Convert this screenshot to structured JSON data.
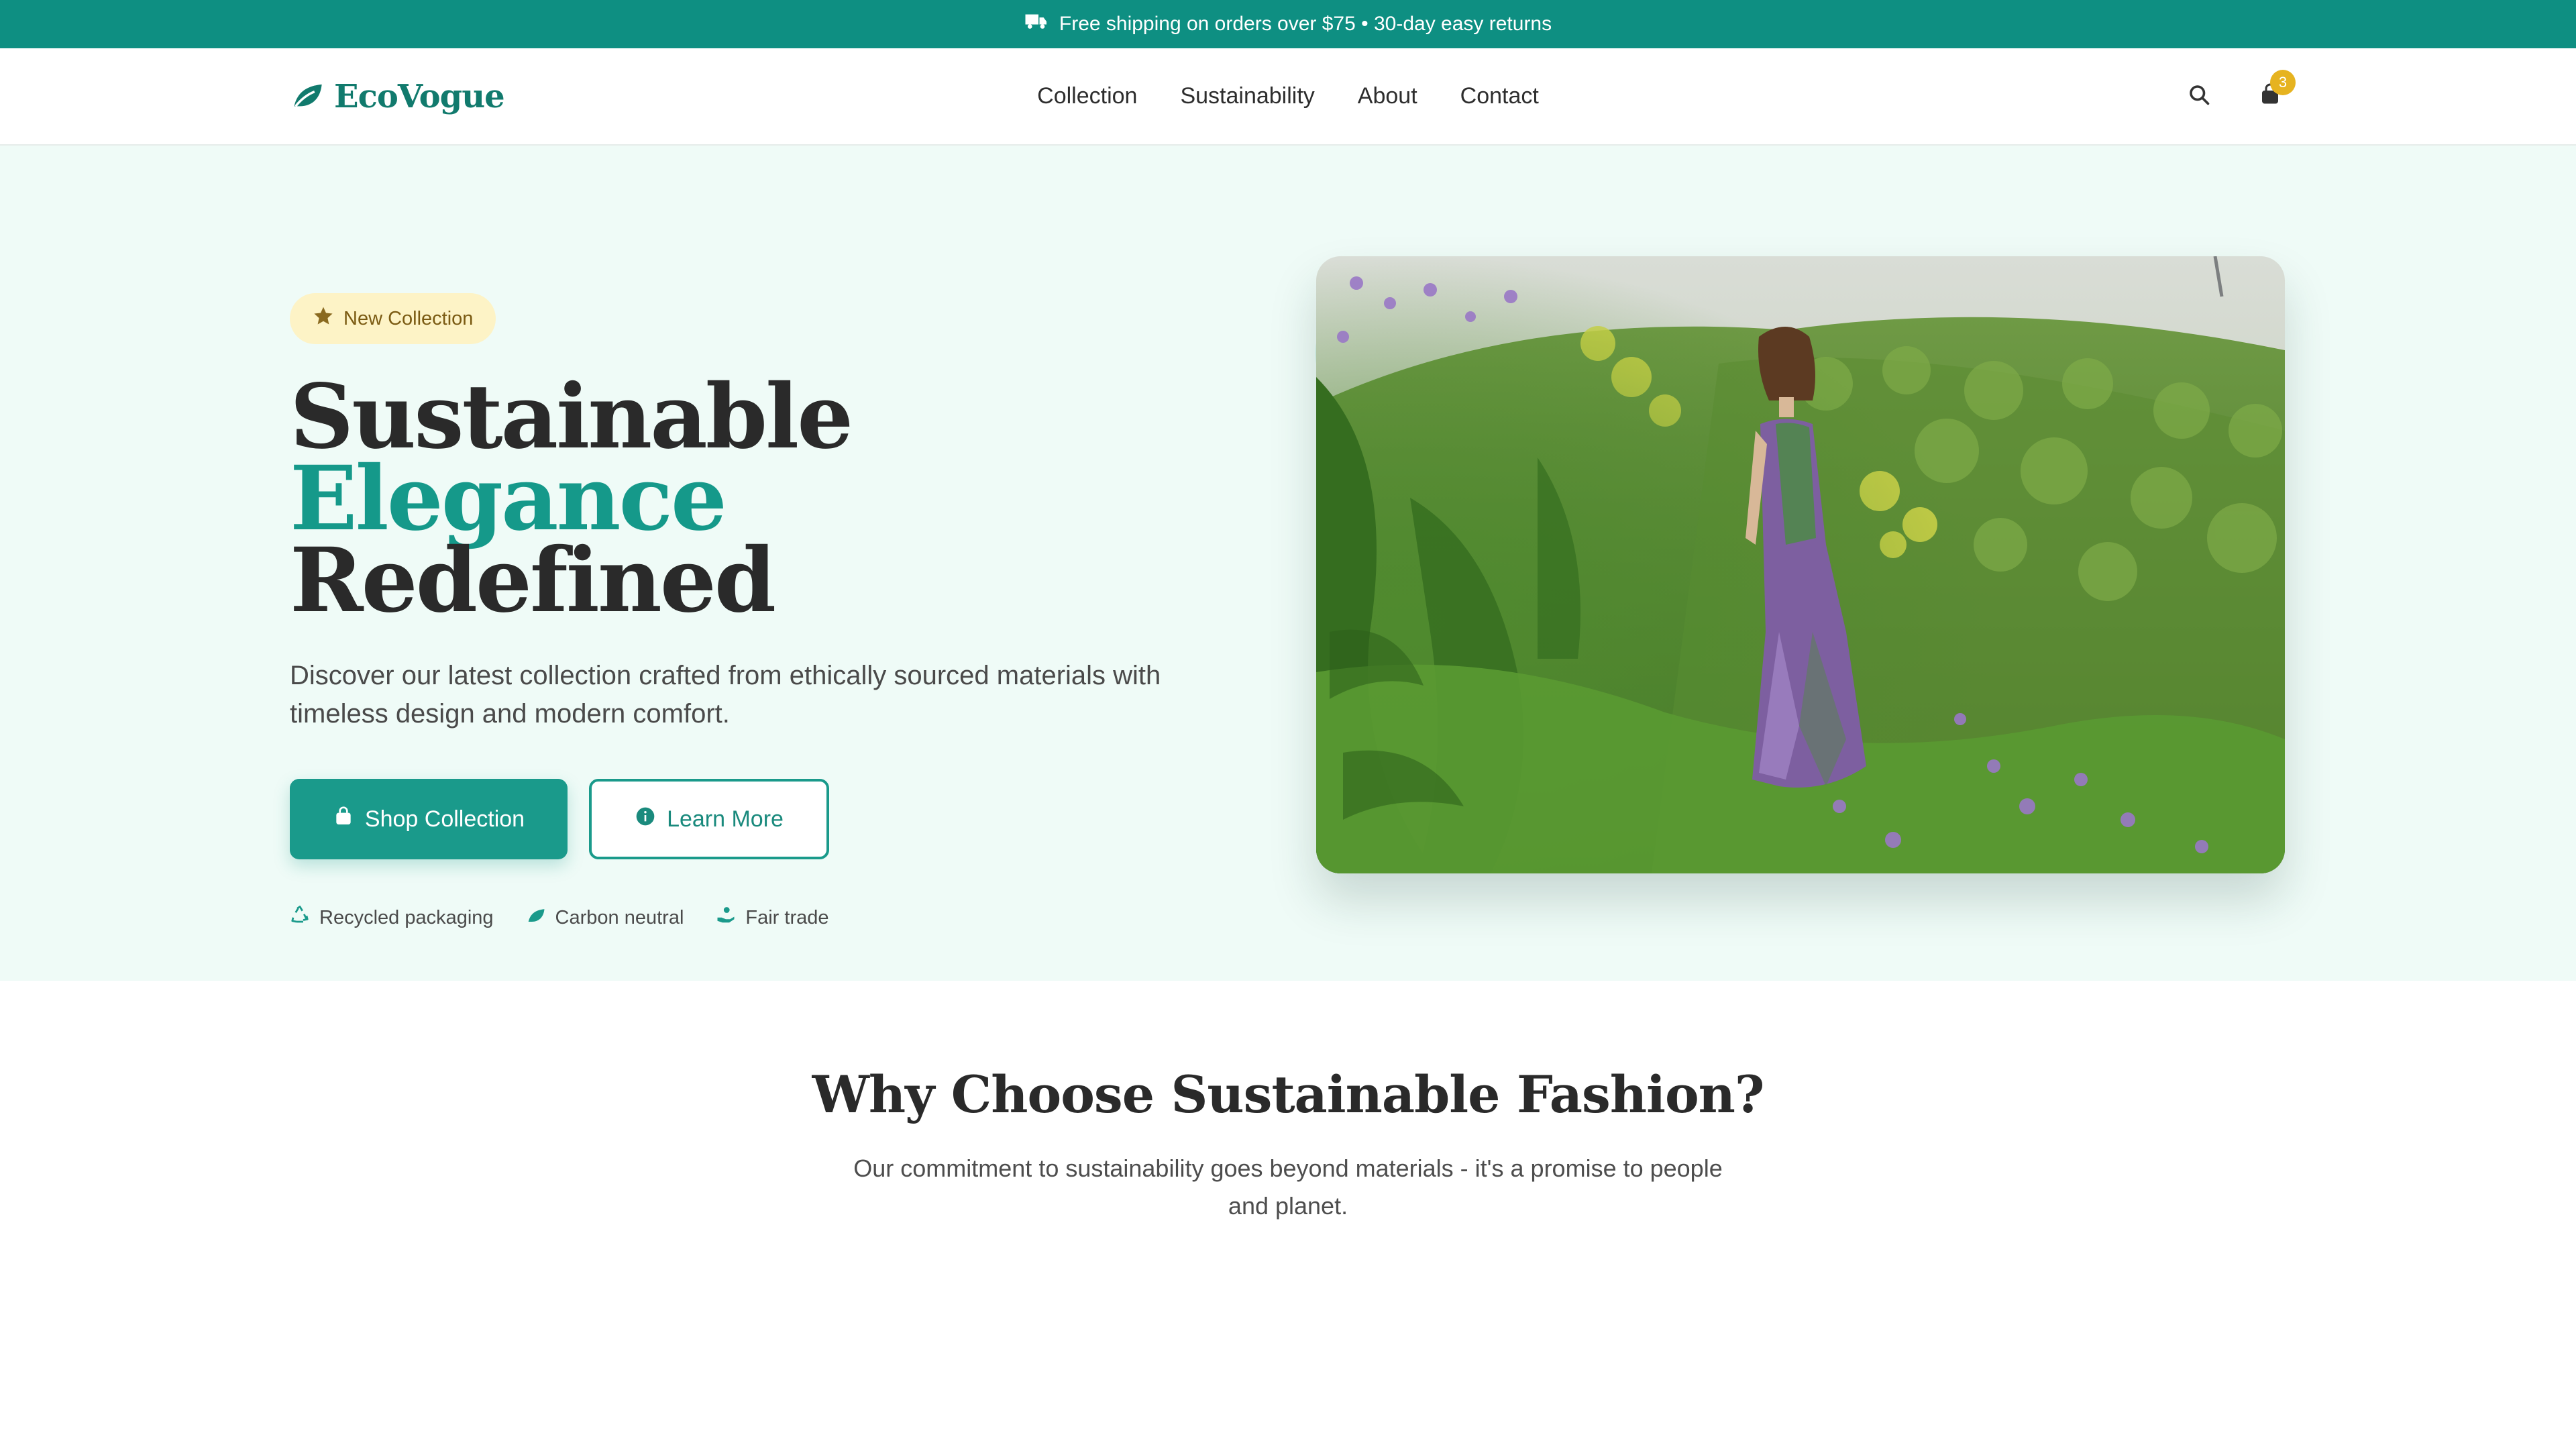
{
  "announcement": {
    "text": "Free shipping on orders over $75 • 30-day easy returns",
    "icon": "truck-icon"
  },
  "header": {
    "brand": "EcoVogue",
    "nav": [
      {
        "label": "Collection"
      },
      {
        "label": "Sustainability"
      },
      {
        "label": "About"
      },
      {
        "label": "Contact"
      }
    ],
    "cart_count": "3"
  },
  "hero": {
    "badge": "New Collection",
    "title_part1": "Sustainable",
    "title_accent": "Elegance",
    "title_part2": "Redefined",
    "subtitle": "Discover our latest collection crafted from ethically sourced materials with timeless design and modern comfort.",
    "primary_button": "Shop Collection",
    "secondary_button": "Learn More",
    "features": [
      {
        "label": "Recycled packaging",
        "icon": "recycle-icon"
      },
      {
        "label": "Carbon neutral",
        "icon": "leaf-icon"
      },
      {
        "label": "Fair trade",
        "icon": "hand-heart-icon"
      }
    ]
  },
  "why": {
    "title": "Why Choose Sustainable Fashion?",
    "subtitle": "Our commitment to sustainability goes beyond materials - it's a promise to people and planet."
  },
  "colors": {
    "brand": "#0e8f82",
    "accent": "#15998a",
    "badge_bg": "#fdf3c6",
    "cart_badge": "#e6b320",
    "hero_bg": "#effbf7"
  }
}
